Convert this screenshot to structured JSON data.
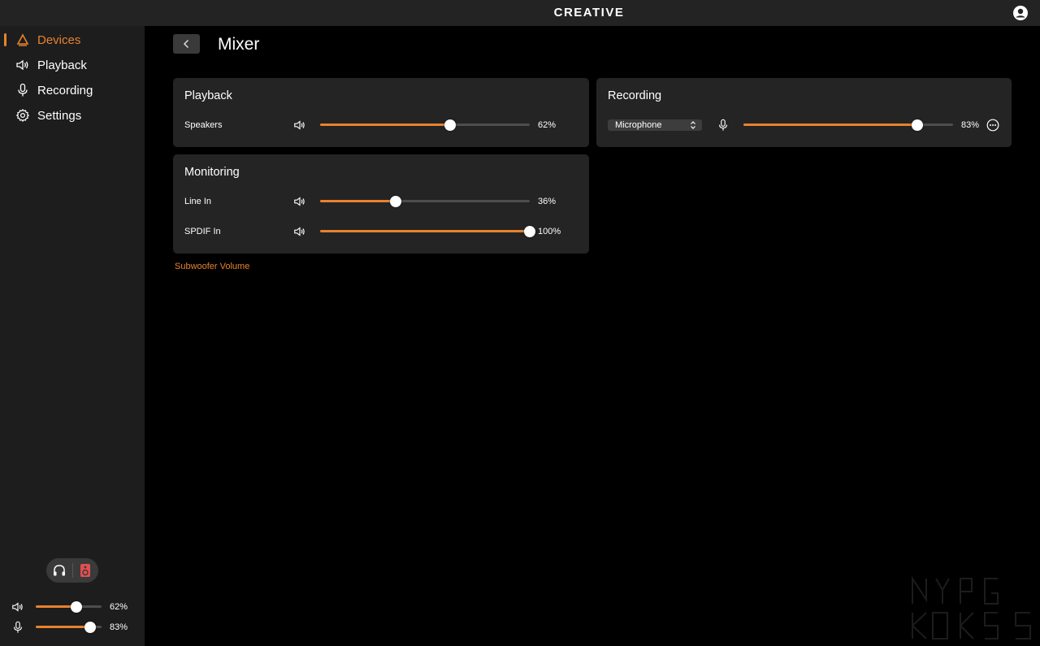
{
  "app": {
    "brand": "CREATIVE"
  },
  "sidebar": {
    "items": [
      {
        "label": "Devices",
        "icon": "devices-icon",
        "active": true
      },
      {
        "label": "Playback",
        "icon": "speaker-icon",
        "active": false
      },
      {
        "label": "Recording",
        "icon": "microphone-icon",
        "active": false
      },
      {
        "label": "Settings",
        "icon": "gear-icon",
        "active": false
      }
    ],
    "output_toggle": {
      "options": [
        "headphones-icon",
        "speaker-device-icon"
      ]
    },
    "master": {
      "playback": {
        "value": 62,
        "label": "62%"
      },
      "recording": {
        "value": 83,
        "label": "83%"
      }
    }
  },
  "page": {
    "title": "Mixer"
  },
  "playback": {
    "title": "Playback",
    "rows": [
      {
        "label": "Speakers",
        "value": 62,
        "display": "62%"
      }
    ]
  },
  "recording": {
    "title": "Recording",
    "source": "Microphone",
    "value": 83,
    "display": "83%"
  },
  "monitoring": {
    "title": "Monitoring",
    "rows": [
      {
        "label": "Line In",
        "value": 36,
        "display": "36%"
      },
      {
        "label": "SPDIF In",
        "value": 100,
        "display": "100%"
      }
    ]
  },
  "subwoofer_link": "Subwoofer Volume",
  "colors": {
    "accent": "#e8822f",
    "card": "#242424",
    "sidebar": "#1d1d1d",
    "background": "#000000"
  }
}
